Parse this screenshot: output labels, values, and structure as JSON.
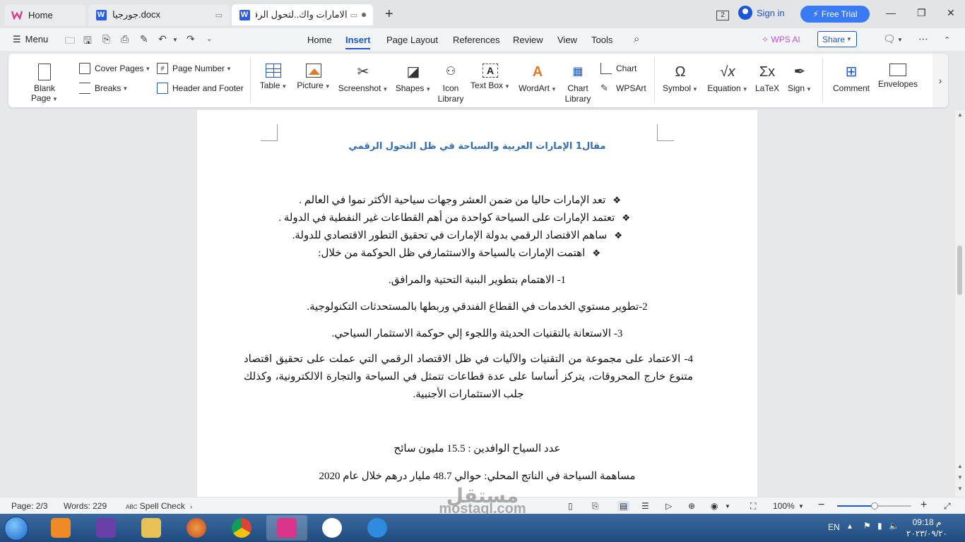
{
  "tabs": [
    {
      "label": "Home",
      "icon": "wps-logo-icon"
    },
    {
      "label": "جورجيا.docx",
      "icon": "word-doc-icon"
    },
    {
      "label": "الامارات واك..لتحول الرقمي",
      "icon": "word-doc-icon"
    }
  ],
  "titlebar": {
    "sign_in": "Sign in",
    "free_trial": "Free Trial",
    "badge": "2"
  },
  "menu": {
    "menu_label": "Menu",
    "tabs": [
      "Home",
      "Insert",
      "Page Layout",
      "References",
      "Review",
      "View",
      "Tools"
    ],
    "active_tab": "Insert",
    "wps_ai": "WPS AI",
    "share": "Share"
  },
  "ribbon": {
    "blank_page": "Blank Page",
    "cover_pages": "Cover Pages",
    "breaks": "Breaks",
    "page_number": "Page Number",
    "header_footer": "Header and Footer",
    "table": "Table",
    "picture": "Picture",
    "screenshot": "Screenshot",
    "shapes": "Shapes",
    "icon_library_1": "Icon",
    "icon_library_2": "Library",
    "text_box": "Text Box",
    "wordart": "WordArt",
    "chart_library_1": "Chart",
    "chart_library_2": "Library",
    "chart": "Chart",
    "wpsart": "WPSArt",
    "symbol": "Symbol",
    "equation": "Equation",
    "latex": "LaTeX",
    "sign": "Sign",
    "comment": "Comment",
    "envelopes": "Envelopes"
  },
  "document": {
    "title": "مقال1 الإمارات العربية والسياحة في ظل التحول الرقمي",
    "bullets": [
      "تعد الإمارات حاليا من ضمن العشر وجهات سياحية الأكثر نموا في العالم .",
      "تعتمد الإمارات على السياحة كواحدة من أهم  القطاعات غير النفطية في الدولة .",
      "ساهم الاقتصاد الرقمي بدولة الإمارات في تحقيق التطور الاقتصادي للدولة.",
      "اهتمت الإمارات بالسياحة والاستثمارفي ظل الحوكمة  من خلال:"
    ],
    "numbered": [
      "1- الاهتمام بتطوير البنية التحتية والمرافق.",
      "2-تطوير  مستوي الخدمات في القطاع الفندقي وربطها بالمستحدثات التكنولوجية.",
      "3- الاستعانة بالتقنيات الحديثة واللجوء إلي حوكمة الاستثمار السياحي."
    ],
    "para4": "4- الاعتماد على مجموعة من التقنيات والآليات في ظل الاقتصاد الرقمي  التي عملت على تحقيق اقتصاد متنوع خارج المحروقات، يتركز أساسا على عدة قطاعات تتمثل في السياحة والتجارة الالكترونية، وكذلك جلب الاستثمارات الأجنبية.",
    "stat1": "عدد السياح الوافدين :   15.5 مليون سائح",
    "stat2": "مساهمة السياحة في الناتج المحلي: حوالي  48.7 مليار درهم خلال عام 2020"
  },
  "status": {
    "page": "Page: 2/3",
    "words": "Words: 229",
    "spell": "Spell Check",
    "zoom": "100%",
    "zoom_fraction": 0.5
  },
  "taskbar": {
    "lang": "EN",
    "time": "09:18 م",
    "date": "٢٠٢٣/٠٩/٢٠"
  },
  "watermark": {
    "line1": "مستقل",
    "line2": "mostaql.com"
  },
  "colors": {
    "accent": "#1a56d6",
    "title": "#2f6db5",
    "free_trial": "#3a7bf5"
  }
}
